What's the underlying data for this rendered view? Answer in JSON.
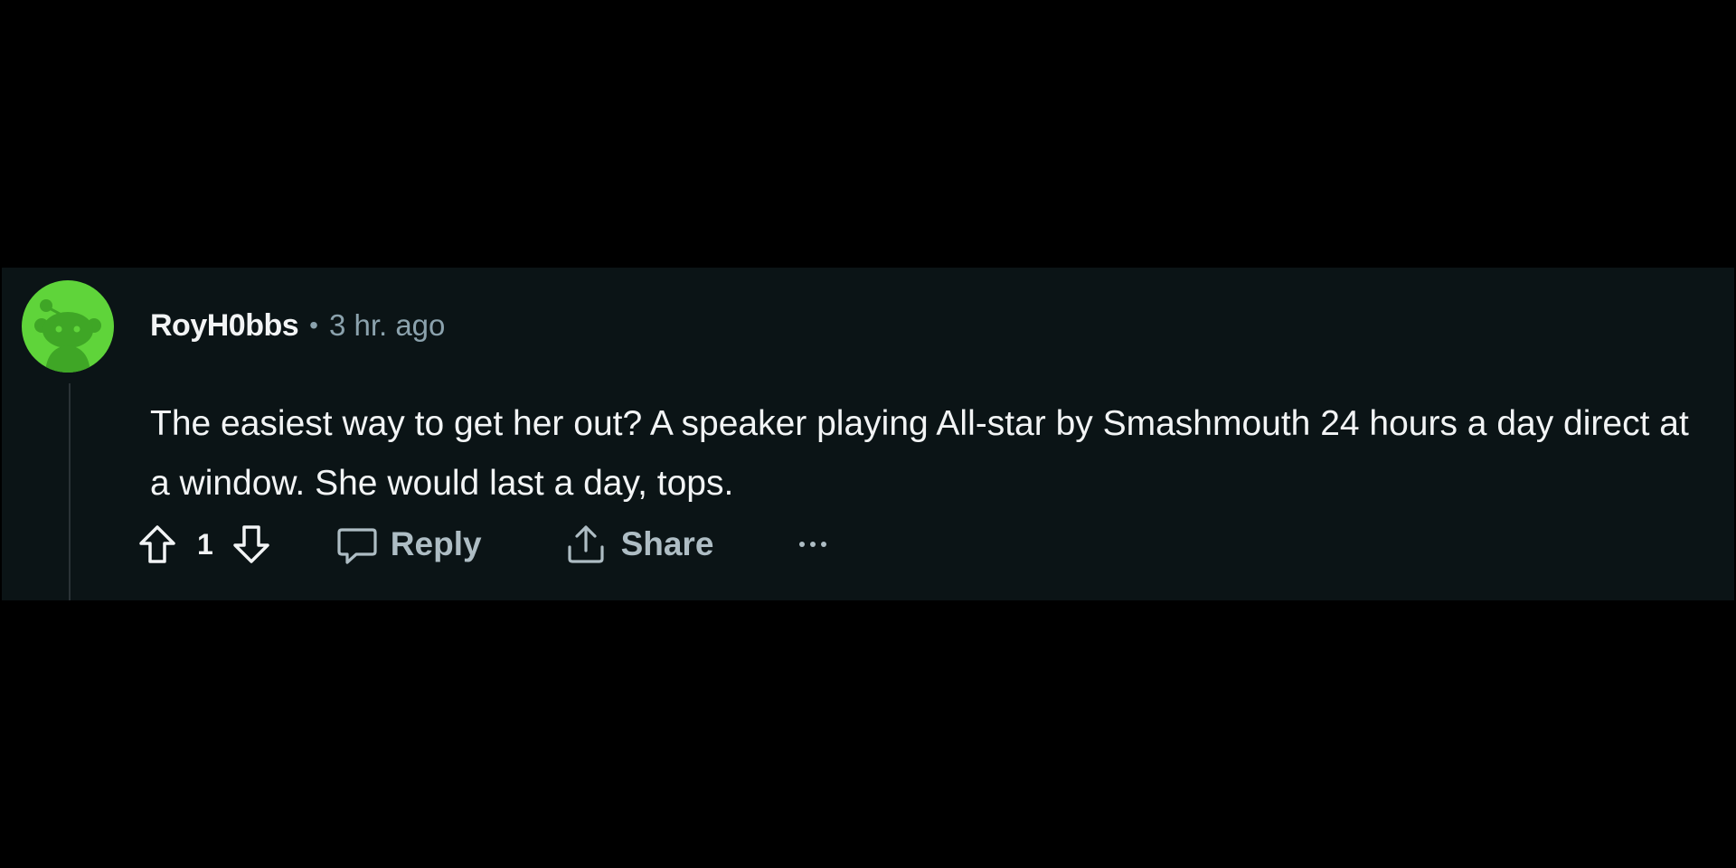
{
  "comment": {
    "username": "RoyH0bbs",
    "separator": "•",
    "timestamp": "3 hr. ago",
    "body": "The easiest way to get her out? A speaker playing All-star by Smashmouth 24 hours a day direct at a window. She would last a day, tops.",
    "avatar_icon": "reddit-snoo-avatar-icon",
    "avatar_color": "#5fd43a"
  },
  "actions": {
    "vote_count": "1",
    "upvote_icon": "arrow-up-icon",
    "downvote_icon": "arrow-down-icon",
    "reply_label": "Reply",
    "reply_icon": "speech-bubble-icon",
    "share_label": "Share",
    "share_icon": "share-upload-icon",
    "more_icon": "ellipsis-icon"
  },
  "colors": {
    "page_background": "#000000",
    "card_background": "#0b1416",
    "primary_text": "#f2f4f5",
    "secondary_text": "#8ba2ad",
    "action_text": "#aebdc4"
  }
}
